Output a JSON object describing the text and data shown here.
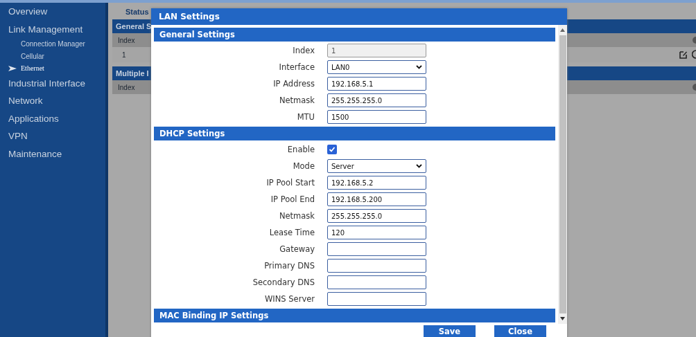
{
  "sidebar": {
    "items": [
      {
        "label": "Overview",
        "selected": false
      },
      {
        "label": "Link Management",
        "selected": false,
        "children": [
          {
            "label": "Connection Manager",
            "selected": false
          },
          {
            "label": "Cellular",
            "selected": false
          },
          {
            "label": "Ethernet",
            "selected": true
          }
        ]
      },
      {
        "label": "Industrial Interface",
        "selected": false
      },
      {
        "label": "Network",
        "selected": false
      },
      {
        "label": "Applications",
        "selected": false
      },
      {
        "label": "VPN",
        "selected": false
      },
      {
        "label": "Maintenance",
        "selected": false
      }
    ]
  },
  "background": {
    "tab": "Status",
    "sections": [
      {
        "title": "General S",
        "columns": [
          "Index"
        ],
        "rows": [
          [
            "1"
          ]
        ]
      },
      {
        "title": "Multiple I",
        "columns": [
          "Index"
        ]
      }
    ]
  },
  "dialog": {
    "title": "LAN Settings",
    "sections": [
      {
        "title": "General Settings",
        "fields": [
          {
            "label": "Index",
            "kind": "text",
            "value": "1",
            "disabled": true
          },
          {
            "label": "Interface",
            "kind": "select",
            "value": "LAN0",
            "disabled": false
          },
          {
            "label": "IP Address",
            "kind": "text",
            "value": "192.168.5.1",
            "disabled": false
          },
          {
            "label": "Netmask",
            "kind": "text",
            "value": "255.255.255.0",
            "disabled": false
          },
          {
            "label": "MTU",
            "kind": "text",
            "value": "1500",
            "disabled": false
          }
        ]
      },
      {
        "title": "DHCP Settings",
        "fields": [
          {
            "label": "Enable",
            "kind": "checkbox",
            "checked": true
          },
          {
            "label": "Mode",
            "kind": "select",
            "value": "Server",
            "disabled": false
          },
          {
            "label": "IP Pool Start",
            "kind": "text",
            "value": "192.168.5.2",
            "disabled": false
          },
          {
            "label": "IP Pool End",
            "kind": "text",
            "value": "192.168.5.200",
            "disabled": false
          },
          {
            "label": "Netmask",
            "kind": "text",
            "value": "255.255.255.0",
            "disabled": false
          },
          {
            "label": "Lease Time",
            "kind": "text",
            "value": "120",
            "disabled": false
          },
          {
            "label": "Gateway",
            "kind": "text",
            "disabled": false
          },
          {
            "label": "Primary DNS",
            "kind": "text",
            "disabled": false
          },
          {
            "label": "Secondary DNS",
            "kind": "text",
            "disabled": false
          },
          {
            "label": "WINS Server",
            "kind": "text",
            "disabled": false
          }
        ]
      },
      {
        "title": "MAC Binding IP Settings"
      }
    ],
    "buttons": [
      "Save",
      "Close"
    ]
  }
}
